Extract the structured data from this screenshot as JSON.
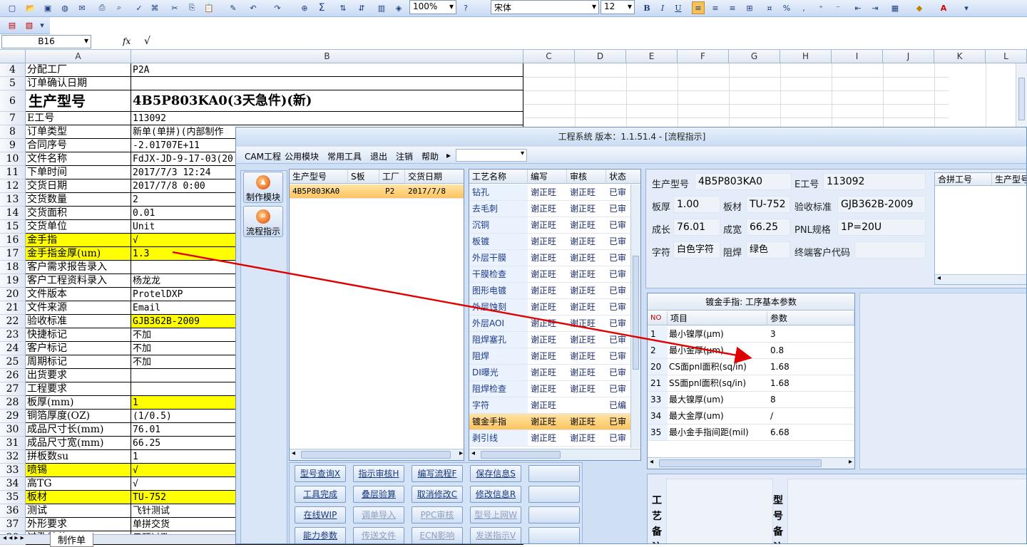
{
  "toolbar": {
    "zoom": "100%",
    "font_name": "宋体",
    "font_size": "12",
    "bold": "B",
    "italic": "I",
    "underline": "U",
    "sum": "Σ",
    "percent": "%",
    "comma": ","
  },
  "formula_bar": {
    "name_box": "B16",
    "fx": "fx",
    "value": "√"
  },
  "columns": [
    "A",
    "B",
    "C",
    "D",
    "E",
    "F",
    "G",
    "H",
    "I",
    "J",
    "K",
    "L"
  ],
  "rows": [
    {
      "num": "4",
      "a": "分配工厂",
      "b": "P2A"
    },
    {
      "num": "5",
      "a": "订单确认日期",
      "b": ""
    },
    {
      "num": "6",
      "a": "生产型号",
      "b": "4B5P803KA0(3天急件)(新)"
    },
    {
      "num": "7",
      "a": "E工号",
      "b": "113092"
    },
    {
      "num": "8",
      "a": "订单类型",
      "b": "新单(单拼)(内部制作"
    },
    {
      "num": "9",
      "a": "合同序号",
      "b": "-2.01707E+11"
    },
    {
      "num": "10",
      "a": "文件名称",
      "b": "FdJX-JD-9-17-03(20"
    },
    {
      "num": "11",
      "a": "下单时间",
      "b": "2017/7/3 12:24"
    },
    {
      "num": "12",
      "a": "交货日期",
      "b": "2017/7/8 0:00"
    },
    {
      "num": "13",
      "a": "交货数量",
      "b": "2"
    },
    {
      "num": "14",
      "a": "交货面积",
      "b": "0.01"
    },
    {
      "num": "15",
      "a": "交货单位",
      "b": "Unit"
    },
    {
      "num": "16",
      "a": "金手指",
      "b": "√"
    },
    {
      "num": "17",
      "a": "金手指金厚(um)",
      "b": "1.3"
    },
    {
      "num": "18",
      "a": "客户需求报告录入",
      "b": ""
    },
    {
      "num": "19",
      "a": "客户工程资料录入",
      "b": "杨龙龙"
    },
    {
      "num": "20",
      "a": "文件版本",
      "b": "ProtelDXP"
    },
    {
      "num": "21",
      "a": "文件来源",
      "b": "Email"
    },
    {
      "num": "22",
      "a": "验收标准",
      "b": "GJB362B-2009"
    },
    {
      "num": "23",
      "a": "快捷标记",
      "b": "不加"
    },
    {
      "num": "24",
      "a": "客户标记",
      "b": "不加"
    },
    {
      "num": "25",
      "a": "周期标记",
      "b": "不加"
    },
    {
      "num": "26",
      "a": "出货要求",
      "b": ""
    },
    {
      "num": "27",
      "a": "工程要求",
      "b": ""
    },
    {
      "num": "28",
      "a": "板厚(mm)",
      "b": "1"
    },
    {
      "num": "29",
      "a": "铜箔厚度(OZ)",
      "b": "(1/0.5)"
    },
    {
      "num": "30",
      "a": "成品尺寸长(mm)",
      "b": "76.01"
    },
    {
      "num": "31",
      "a": "成品尺寸宽(mm)",
      "b": "66.25"
    },
    {
      "num": "32",
      "a": "拼板数su",
      "b": "1"
    },
    {
      "num": "33",
      "a": "喷锡",
      "b": "√"
    },
    {
      "num": "34",
      "a": "高TG",
      "b": "√"
    },
    {
      "num": "35",
      "a": "板材",
      "b": "TU-752"
    },
    {
      "num": "36",
      "a": "测试",
      "b": "飞针测试"
    },
    {
      "num": "37",
      "a": "外形要求",
      "b": "单拼交货"
    },
    {
      "num": "38",
      "a": "过孔着落",
      "b": "只顶过孔"
    }
  ],
  "sheet_tab": "制作单",
  "app": {
    "title": "工程系统  版本：1.1.51.4 - [流程指示]",
    "menu": [
      "CAM工程",
      "公用模块",
      "常用工具",
      "退出",
      "注销",
      "帮助"
    ],
    "side_buttons": [
      "制作模块",
      "流程指示"
    ],
    "order_grid": {
      "headers": [
        "生产型号",
        "S板",
        "工厂",
        "交货日期"
      ],
      "row": [
        "4B5P803KA0",
        "",
        "P2",
        "2017/7/8"
      ]
    },
    "process_grid": {
      "headers": [
        "工艺名称",
        "编写",
        "审核",
        "状态"
      ],
      "rows": [
        [
          "钻孔",
          "谢正旺",
          "谢正旺",
          "已审"
        ],
        [
          "去毛刺",
          "谢正旺",
          "谢正旺",
          "已审"
        ],
        [
          "沉铜",
          "谢正旺",
          "谢正旺",
          "已审"
        ],
        [
          "板镀",
          "谢正旺",
          "谢正旺",
          "已审"
        ],
        [
          "外层干膜",
          "谢正旺",
          "谢正旺",
          "已审"
        ],
        [
          "干膜检查",
          "谢正旺",
          "谢正旺",
          "已审"
        ],
        [
          "图形电镀",
          "谢正旺",
          "谢正旺",
          "已审"
        ],
        [
          "外层蚀刻",
          "谢正旺",
          "谢正旺",
          "已审"
        ],
        [
          "外层AOI",
          "谢正旺",
          "谢正旺",
          "已审"
        ],
        [
          "阻焊塞孔",
          "谢正旺",
          "谢正旺",
          "已审"
        ],
        [
          "阻焊",
          "谢正旺",
          "谢正旺",
          "已审"
        ],
        [
          "DI曝光",
          "谢正旺",
          "谢正旺",
          "已审"
        ],
        [
          "阻焊检查",
          "谢正旺",
          "谢正旺",
          "已审"
        ],
        [
          "字符",
          "谢正旺",
          "",
          "已编"
        ],
        [
          "镀金手指",
          "谢正旺",
          "谢正旺",
          "已审"
        ],
        [
          "剥引线",
          "谢正旺",
          "谢正旺",
          "已审"
        ]
      ]
    },
    "buttons": [
      [
        "型号查询X",
        "指示审核H",
        "编写流程F",
        "保存信息S",
        ""
      ],
      [
        "工具完成",
        "叠层验算",
        "取消修改C",
        "修改信息R",
        ""
      ],
      [
        "在线WIP",
        "调单导入",
        "PPC审核",
        "型号上网W",
        ""
      ],
      [
        "能力参数",
        "传送文件",
        "ECN影响",
        "发送指示V",
        ""
      ]
    ],
    "info": {
      "model_label": "生产型号",
      "model": "4B5P803KA0",
      "e_label": "E工号",
      "e": "113092",
      "thick_label": "板厚",
      "thick": "1.00",
      "mat_label": "板材",
      "mat": "TU-752",
      "std_label": "验收标准",
      "std": "GJB362B-2009",
      "len_label": "成长",
      "len": "76.01",
      "wid_label": "成宽",
      "wid": "66.25",
      "pnl_label": "PNL规格",
      "pnl": "1P=20U",
      "char_label": "字符",
      "char": "白色字符",
      "mask_label": "阻焊",
      "mask": "绿色",
      "cust_label": "终端客户代码",
      "cust": ""
    },
    "merge_grid": {
      "headers": [
        "合拼工号",
        "生产型号"
      ]
    },
    "params": {
      "title": "镀金手指: 工序基本参数",
      "headers": [
        "NO",
        "项目",
        "参数"
      ],
      "rows": [
        [
          "1",
          "最小镍厚(μm)",
          "3"
        ],
        [
          "2",
          "最小金厚(μm)",
          "0.8"
        ],
        [
          "20",
          "CS面pnl面积(sq/in)",
          "1.68"
        ],
        [
          "21",
          "SS面pnl面积(sq/in)",
          "1.68"
        ],
        [
          "33",
          "最大镍厚(um)",
          "8"
        ],
        [
          "34",
          "最大金厚(um)",
          "/"
        ],
        [
          "35",
          "最小金手指间距(mil)",
          "6.68"
        ]
      ]
    },
    "notes": {
      "left": "工艺备注",
      "right": "型号备注"
    }
  }
}
